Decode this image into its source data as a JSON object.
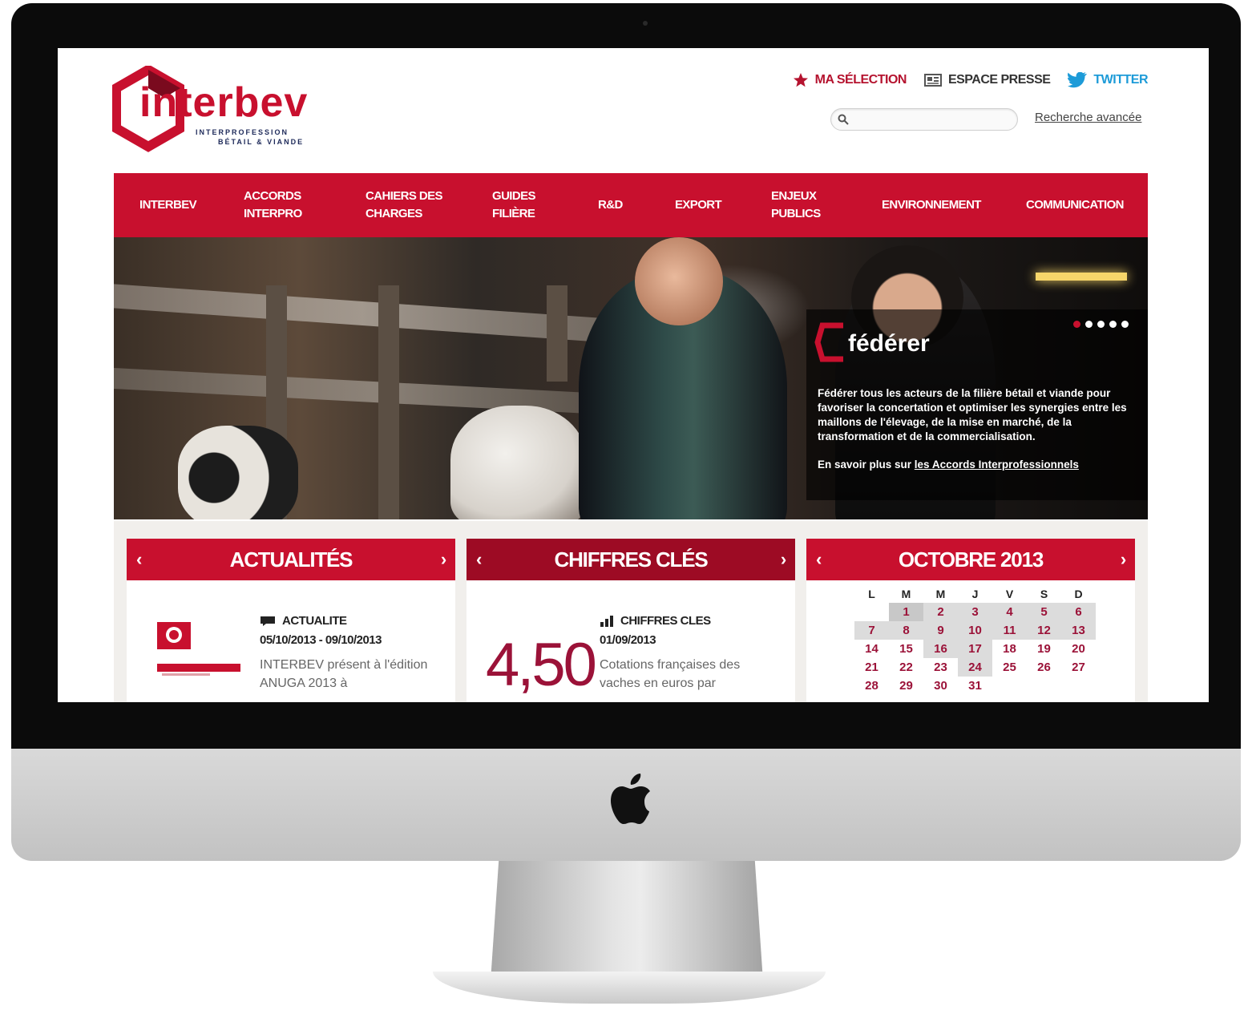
{
  "logo": {
    "word": "interbev",
    "sub1": "INTERPROFESSION",
    "sub2": "BÉTAIL & VIANDE"
  },
  "header": {
    "links": [
      {
        "label": "MA SÉLECTION",
        "icon": "star-icon"
      },
      {
        "label": "ESPACE PRESSE",
        "icon": "newspaper-icon"
      },
      {
        "label": "TWITTER",
        "icon": "twitter-bird-icon"
      }
    ],
    "search": {
      "value": "",
      "placeholder": ""
    },
    "advanced_search": "Recherche avancée"
  },
  "nav": [
    "INTERBEV",
    "ACCORDS\nINTERPRO",
    "CAHIERS DES\nCHARGES",
    "GUIDES\nFILIÈRE",
    "R&D",
    "EXPORT",
    "ENJEUX\nPUBLICS",
    "ENVIRONNEMENT",
    "COMMUNICATION"
  ],
  "hero": {
    "title": "fédérer",
    "text": "Fédérer tous les acteurs de la filière bétail et viande pour favoriser la concertation et optimiser les synergies entre les maillons de l'élevage, de la mise en marché, de la transformation et de la commercialisation.",
    "more_prefix": "En savoir plus sur ",
    "more_link": "les Accords Interprofessionnels",
    "slides_total": 5,
    "slide_active": 1
  },
  "panels": {
    "news": {
      "title": "ACTUALITÉS",
      "category": "ACTUALITE",
      "date": "05/10/2013 - 09/10/2013",
      "text": "INTERBEV présent à l'édition ANUGA 2013 à"
    },
    "figures": {
      "title": "CHIFFRES CLÉS",
      "category": "CHIFFRES CLES",
      "date": "01/09/2013",
      "number": "4,50",
      "text": "Cotations françaises des vaches en euros par"
    },
    "calendar": {
      "title": "OCTOBRE 2013",
      "weekdays": [
        "L",
        "M",
        "M",
        "J",
        "V",
        "S",
        "D"
      ],
      "weeks": [
        [
          "",
          "1",
          "2",
          "3",
          "4",
          "5",
          "6"
        ],
        [
          "7",
          "8",
          "9",
          "10",
          "11",
          "12",
          "13"
        ],
        [
          "14",
          "15",
          "16",
          "17",
          "18",
          "19",
          "20"
        ],
        [
          "21",
          "22",
          "23",
          "24",
          "25",
          "26",
          "27"
        ],
        [
          "28",
          "29",
          "30",
          "31",
          "",
          "",
          ""
        ]
      ]
    }
  },
  "colors": {
    "brand_red": "#c8102e",
    "dark_red": "#9d0b24",
    "twitter_blue": "#1d9bd8"
  }
}
